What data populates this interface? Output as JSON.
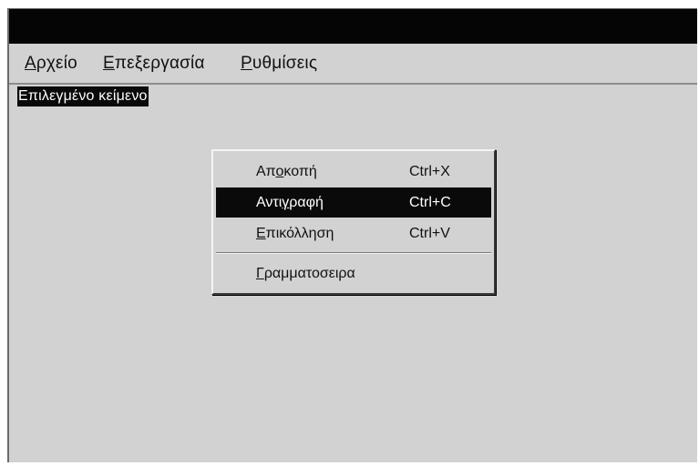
{
  "menubar": {
    "items": [
      {
        "first": "Α",
        "rest": "ρχείο"
      },
      {
        "first": "Ε",
        "rest": "πεξεργασία"
      },
      {
        "first": "Ρ",
        "rest": "υθμίσεις"
      }
    ]
  },
  "content": {
    "selected_text": "Επιλεγμένο κείμενο"
  },
  "context_menu": {
    "items": [
      {
        "pre": "Απ",
        "ul": "ο",
        "post": "κοπή",
        "shortcut": "Ctrl+X",
        "highlighted": false
      },
      {
        "pre": "Αντι",
        "ul": "γ",
        "post": "ραφή",
        "shortcut": "Ctrl+C",
        "highlighted": true
      },
      {
        "pre": "",
        "ul": "Ε",
        "post": "πικόλληση",
        "shortcut": "Ctrl+V",
        "highlighted": false
      },
      {
        "pre": "",
        "ul": "Γ",
        "post": "ραμματοσειρα",
        "shortcut": "",
        "highlighted": false
      }
    ]
  },
  "colors": {
    "titlebar": "#050505",
    "window_bg": "#d2d2d2",
    "highlight_bg": "#0a0a0a",
    "highlight_fg": "#ffffff"
  }
}
